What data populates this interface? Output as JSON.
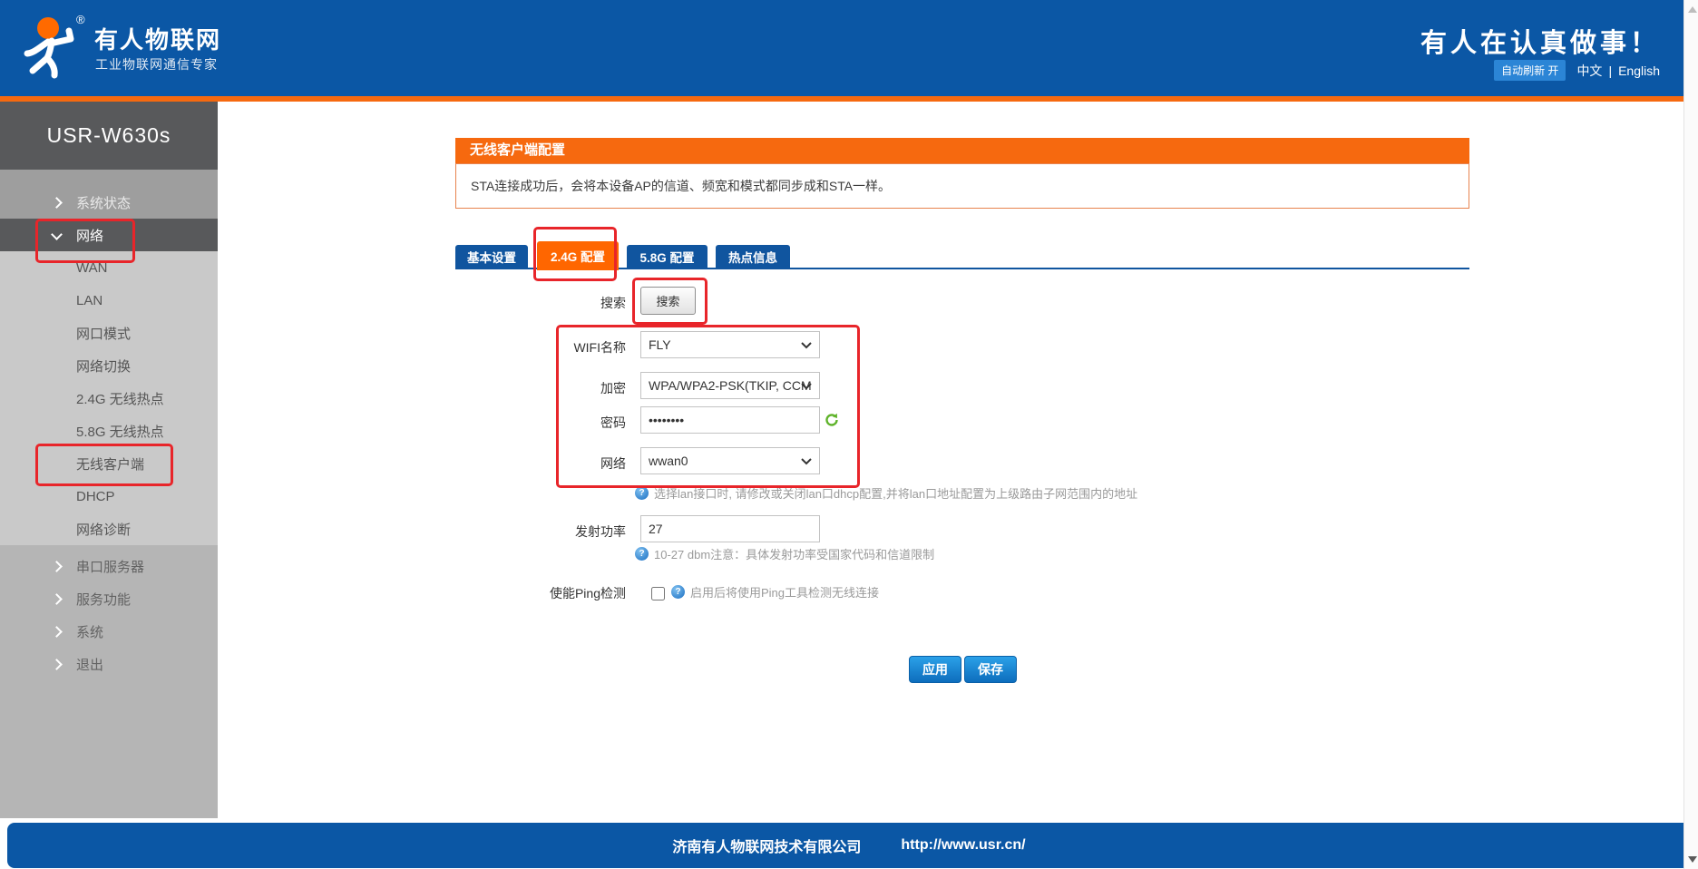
{
  "colors": {
    "header_blue": "#0b57a5",
    "accent_orange": "#f6690f",
    "active_tab_orange": "#ff6600",
    "tab_blue": "#10559f",
    "annotation_red": "#e8252a",
    "button_blue": "#1488d8",
    "refresh_green": "#5fb32a",
    "sidebar_dark": "#58595b"
  },
  "header": {
    "brand_title": "有人物联网",
    "brand_subtitle": "工业物联网通信专家",
    "registered_mark": "®",
    "slogan": "有人在认真做事！",
    "auto_refresh_badge": "自动刷新 开",
    "lang_zh": "中文",
    "lang_sep": "|",
    "lang_en": "English"
  },
  "sidebar": {
    "device_title": "USR-W630s",
    "item_system_status": "系统状态",
    "item_network": "网络",
    "network_subitems": [
      "WAN",
      "LAN",
      "网口模式",
      "网络切换",
      "2.4G 无线热点",
      "5.8G 无线热点",
      "无线客户端",
      "DHCP",
      "网络诊断"
    ],
    "bottom_items": [
      "串口服务器",
      "服务功能",
      "系统",
      "退出"
    ]
  },
  "main": {
    "panel_title": "无线客户端配置",
    "panel_description": "STA连接成功后，会将本设备AP的信道、频宽和模式都同步成和STA一样。",
    "tabs": [
      "基本设置",
      "2.4G 配置",
      "5.8G 配置",
      "热点信息"
    ],
    "active_tab": "2.4G 配置",
    "form": {
      "search_label": "搜索",
      "search_button": "搜索",
      "wifi_name_label": "WIFI名称",
      "wifi_name_value": "FLY",
      "encryption_label": "加密",
      "encryption_value": "WPA/WPA2-PSK(TKIP, CCM",
      "password_label": "密码",
      "password_value": "••••••••",
      "network_label": "网络",
      "network_value": "wwan0",
      "network_hint": "选择lan接口时, 请修改或关闭lan口dhcp配置,并将lan口地址配置为上级路由子网范围内的地址",
      "tx_power_label": "发射功率",
      "tx_power_value": "27",
      "tx_power_hint": "10-27 dbm注意：具体发射功率受国家代码和信道限制",
      "ping_label": "使能Ping检测",
      "ping_checked": false,
      "ping_hint": "启用后将使用Ping工具检测无线连接",
      "apply_button": "应用",
      "save_button": "保存"
    }
  },
  "footer": {
    "company": "济南有人物联网技术有限公司",
    "website": "http://www.usr.cn/"
  }
}
